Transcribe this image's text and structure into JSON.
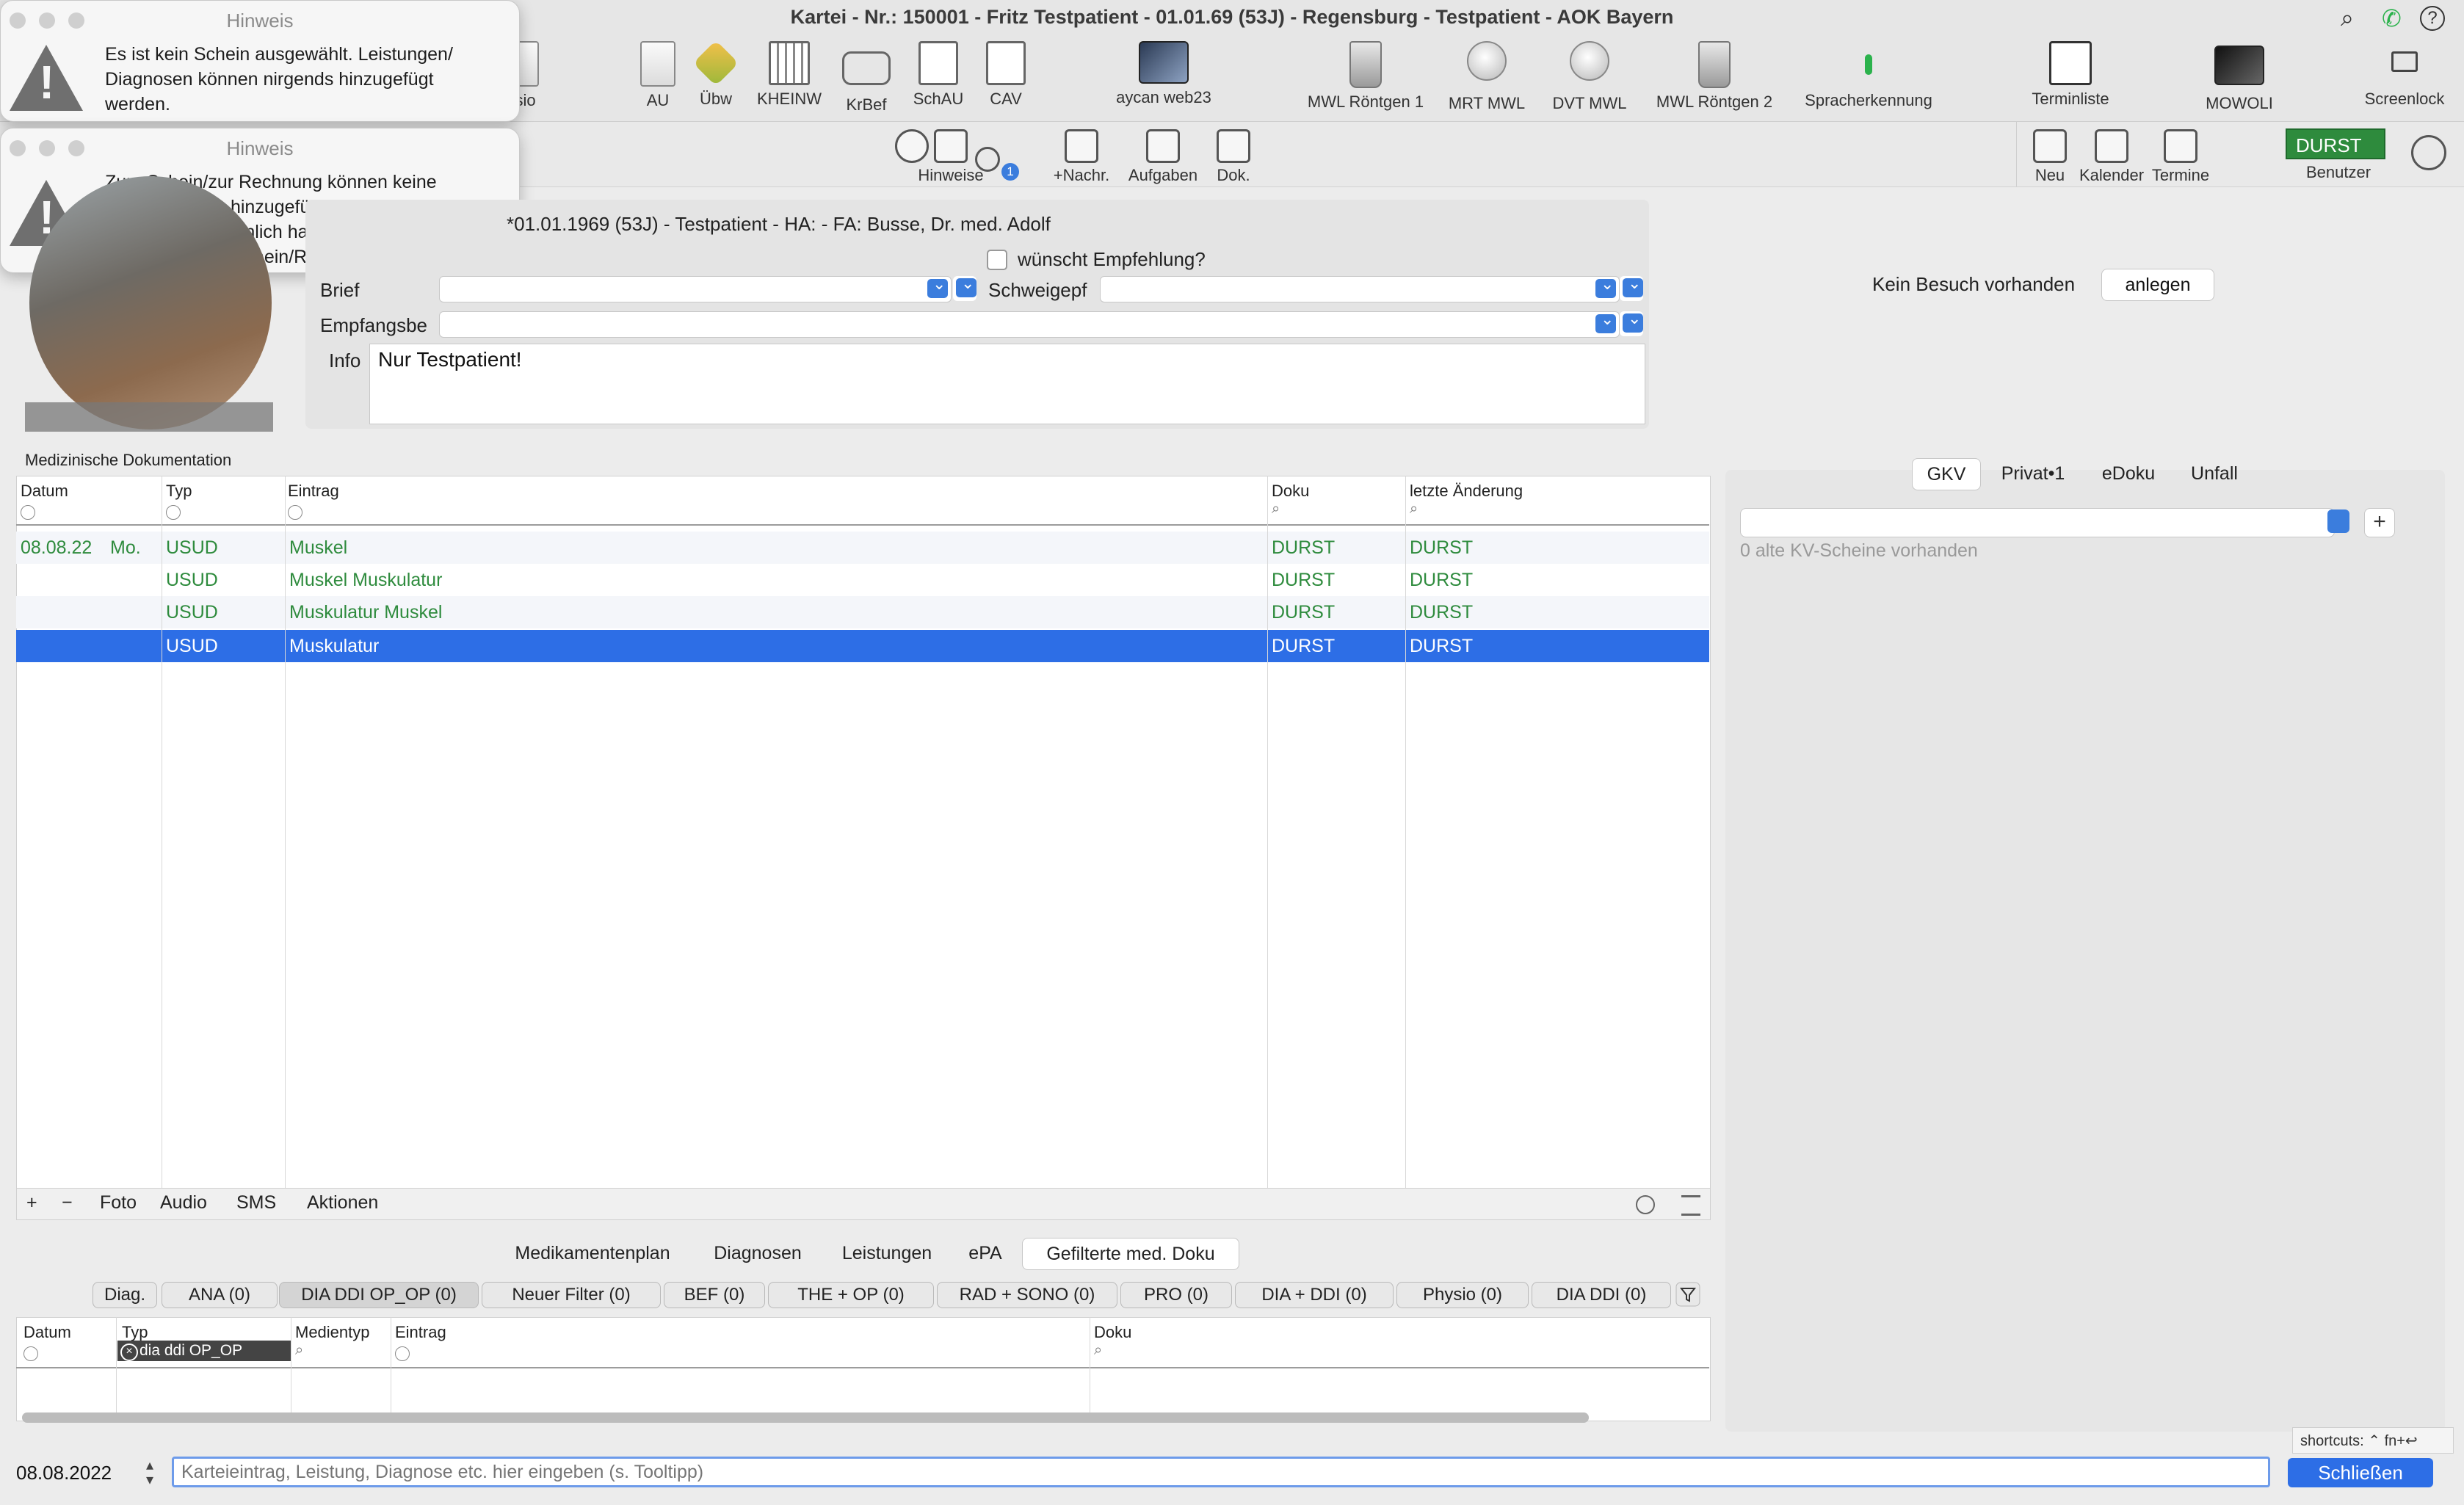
{
  "window": {
    "title": "Kartei - Nr.: 150001 - Fritz Testpatient - 01.01.69 (53J) - Regensburg - Testpatient - AOK Bayern"
  },
  "toolbar": {
    "items": [
      {
        "label": "AU",
        "icon": "au-form-icon"
      },
      {
        "label": "Übw",
        "icon": "referral-icon"
      },
      {
        "label": "KHEINW",
        "icon": "hospital-icon"
      },
      {
        "label": "KrBef",
        "icon": "ambulance-icon"
      },
      {
        "label": "SchAU",
        "icon": "school-au-icon"
      },
      {
        "label": "CAV",
        "icon": "clipboard-add-icon"
      },
      {
        "label": "aycan web23",
        "icon": "aycan-web-icon"
      },
      {
        "label": "MWL Röntgen 1",
        "icon": "xray-tube-icon"
      },
      {
        "label": "MRT MWL",
        "icon": "mrt-icon"
      },
      {
        "label": "DVT MWL",
        "icon": "dvt-icon"
      },
      {
        "label": "MWL Röntgen 2",
        "icon": "xray-tube-icon"
      },
      {
        "label": "Spracherkennung",
        "icon": "microphone-icon"
      },
      {
        "label": "Terminliste",
        "icon": "calendar-list-icon"
      },
      {
        "label": "MOWOLI",
        "icon": "ultrasound-icon"
      },
      {
        "label": "Screenlock",
        "icon": "monitor-lock-icon"
      }
    ],
    "physio_fragment": "ysio",
    "row2": [
      {
        "label": "Hinweise",
        "icon": "hint-icon"
      },
      {
        "label": "+Nachr.",
        "icon": "message-icon"
      },
      {
        "label": "Aufgaben",
        "icon": "tasks-icon"
      },
      {
        "label": "Dok.",
        "icon": "book-icon"
      },
      {
        "label": "Neu",
        "icon": "calendar-new-icon"
      },
      {
        "label": "Kalender",
        "icon": "calendar-icon"
      },
      {
        "label": "Termine",
        "icon": "appointments-icon"
      }
    ],
    "alarm_badge": "1",
    "user_badge": "DURST",
    "user_label": "Benutzer"
  },
  "alerts": [
    {
      "title": "Hinweis",
      "message": "Es ist kein Schein ausgewählt. Leistungen/ Diagnosen können nirgends hinzugefügt werden."
    },
    {
      "title": "Hinweis",
      "message": "Zum Schein/zur Rechnung können keine Angaben mehr hinzugefügt werden. Höchstwahrscheinlich handelt es sich um einen abgerechneten Schein/Rechnung."
    }
  ],
  "patient": {
    "info_line": "*01.01.1969 (53J) - Testpatient - HA:  - FA: Busse, Dr. med. Adolf",
    "recommend_label": "wünscht Empfehlung?",
    "brief_label": "Brief",
    "schweige_label": "Schweigepf",
    "empfang_label": "Empfangsbe",
    "info_label": "Info",
    "info_text": "Nur Testpatient!",
    "visit_text": "Kein Besuch vorhanden",
    "anlegen_label": "anlegen"
  },
  "med_doc": {
    "title": "Medizinische Dokumentation",
    "columns": [
      "Datum",
      "Typ",
      "Eintrag",
      "Doku",
      "letzte Änderung"
    ],
    "rows": [
      {
        "datum": "08.08.22",
        "tag": "Mo.",
        "typ": "USUD",
        "eintrag": "Muskel",
        "doku": "DURST",
        "aenderung": "DURST"
      },
      {
        "datum": "",
        "tag": "",
        "typ": "USUD",
        "eintrag": "Muskel Muskulatur",
        "doku": "DURST",
        "aenderung": "DURST"
      },
      {
        "datum": "",
        "tag": "",
        "typ": "USUD",
        "eintrag": "Muskulatur Muskel",
        "doku": "DURST",
        "aenderung": "DURST"
      },
      {
        "datum": "",
        "tag": "",
        "typ": "USUD",
        "eintrag": "Muskulatur",
        "doku": "DURST",
        "aenderung": "DURST"
      }
    ],
    "footer": [
      "+",
      "−",
      "Foto",
      "Audio",
      "SMS",
      "Aktionen"
    ]
  },
  "right_panel": {
    "tabs": [
      "GKV",
      "Privat•1",
      "eDoku",
      "Unfall"
    ],
    "kv_text": "0 alte KV-Scheine vorhanden"
  },
  "bottom": {
    "tabs": [
      "Medikamentenplan",
      "Diagnosen",
      "Leistungen",
      "ePA",
      "Gefilterte med. Doku"
    ],
    "filters": [
      "Diag.",
      "ANA (0)",
      "DIA DDI OP_OP (0)",
      "Neuer Filter (0)",
      "BEF (0)",
      "THE + OP (0)",
      "RAD + SONO (0)",
      "PRO (0)",
      "DIA + DDI (0)",
      "Physio (0)",
      "DIA DDI (0)"
    ],
    "columns": [
      "Datum",
      "Typ",
      "Medientyp",
      "Eintrag",
      "Doku"
    ],
    "typ_chip": "dia ddi OP_OP"
  },
  "entry": {
    "date": "08.08.2022",
    "placeholder": "Karteieintrag, Leistung, Diagnose etc. hier eingeben (s. Tooltipp)",
    "close_label": "Schließen",
    "shortcuts": "shortcuts: ⌃  fn+↩"
  },
  "colors": {
    "accent": "#2d6ee6",
    "green_text": "#2e8b3d",
    "user_badge": "#2e8b3d"
  }
}
